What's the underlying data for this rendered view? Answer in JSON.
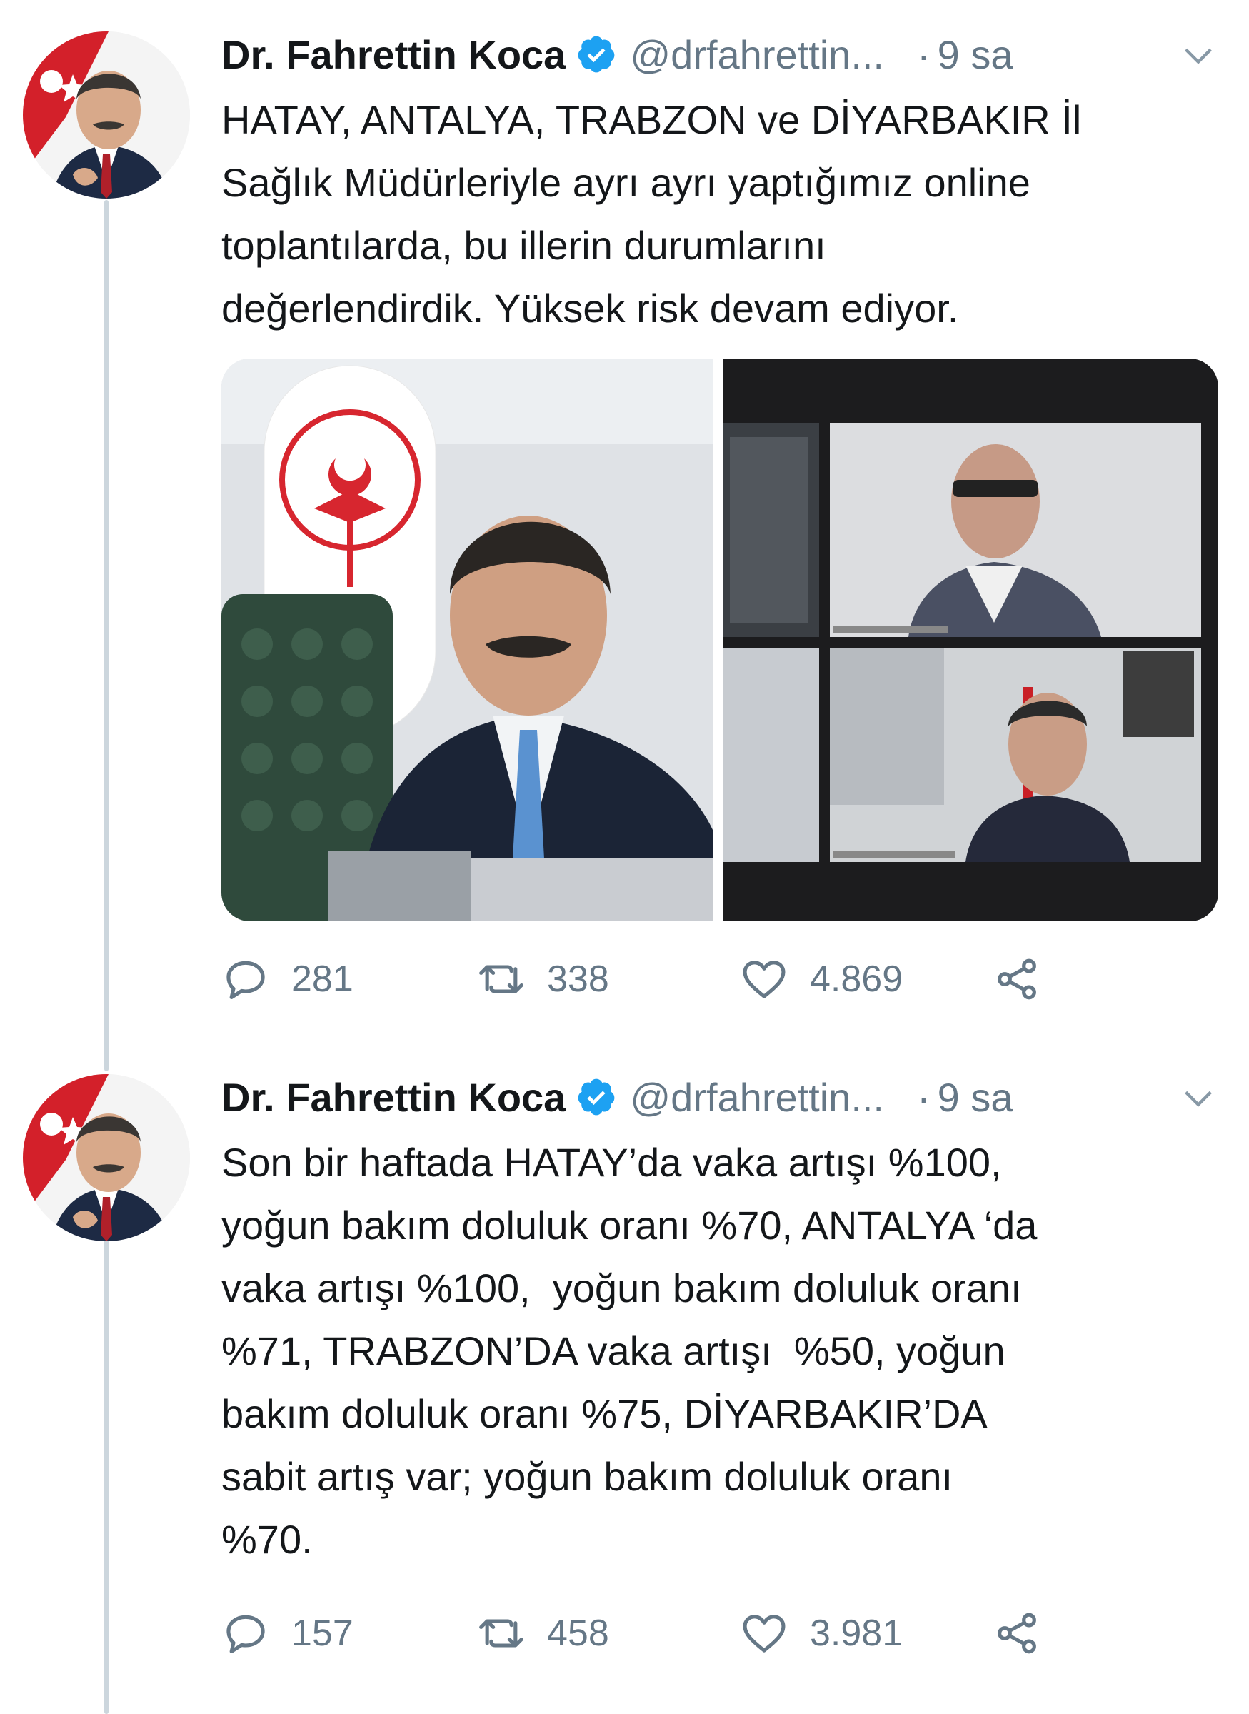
{
  "tweets": [
    {
      "author_name": "Dr. Fahrettin Koca",
      "handle": "@drfahrettin...",
      "separator": "·",
      "time": "9 sa",
      "text": "HATAY, ANTALYA, TRABZON ve DİYARBAKIR İl\nSağlık Müdürleriyle ayrı ayrı yaptığımız online\ntoplantılarda, bu illerin durumlarını\ndeğerlendirdik. Yüksek risk devam ediyor.",
      "has_media": true,
      "replies": "281",
      "retweets": "338",
      "likes": "4.869"
    },
    {
      "author_name": "Dr. Fahrettin Koca",
      "handle": "@drfahrettin...",
      "separator": "·",
      "time": "9 sa",
      "text": "Son bir haftada HATAY’da vaka artışı %100,\nyoğun bakım doluluk oranı %70, ANTALYA ‘da\nvaka artışı %100,  yoğun bakım doluluk oranı\n%71, TRABZON’DA vaka artışı  %50, yoğun\nbakım doluluk oranı %75, DİYARBAKIR’DA\nsabit artış var; yoğun bakım doluluk oranı\n%70.",
      "has_media": false,
      "replies": "157",
      "retweets": "458",
      "likes": "3.981"
    }
  ],
  "colors": {
    "verified_blue": "#1da1f2",
    "secondary_text": "#657786",
    "thread_line": "#ccd6dd"
  },
  "icons": [
    "verified-icon",
    "chevron-down-icon",
    "reply-icon",
    "retweet-icon",
    "like-icon",
    "share-icon"
  ]
}
